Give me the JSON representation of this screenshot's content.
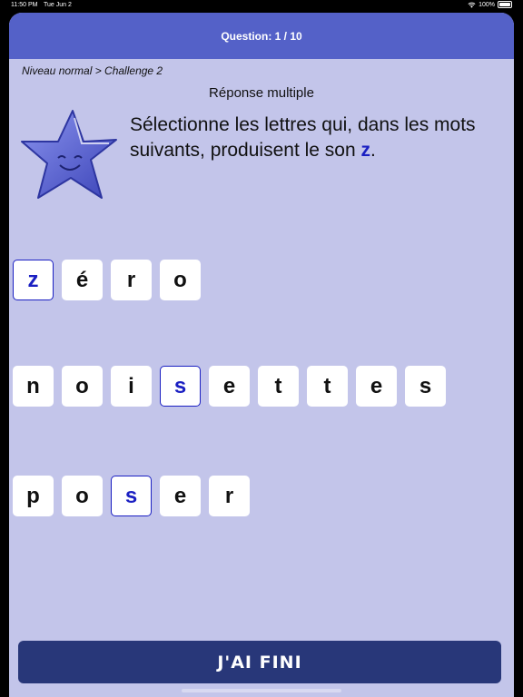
{
  "status": {
    "time": "11:50 PM",
    "date": "Tue Jun 2",
    "battery": "100%"
  },
  "header": {
    "title": "Question: 1 / 10"
  },
  "breadcrumb": "Niveau normal > Challenge 2",
  "question": {
    "type": "Réponse multiple",
    "instruction": "Sélectionne les lettres qui, dans les mots suivants, produisent le son ",
    "target_sound": "z",
    "end": "."
  },
  "words": [
    {
      "letters": [
        "z",
        "é",
        "r",
        "o"
      ],
      "selected": [
        0
      ]
    },
    {
      "letters": [
        "n",
        "o",
        "i",
        "s",
        "e",
        "t",
        "t",
        "e",
        "s"
      ],
      "selected": [
        3
      ]
    },
    {
      "letters": [
        "p",
        "o",
        "s",
        "e",
        "r"
      ],
      "selected": [
        2
      ]
    }
  ],
  "finish_button": "J'AI FINI",
  "colors": {
    "header": "#5461c8",
    "background": "#c3c5ea",
    "accent": "#1a1fc2",
    "button": "#283779"
  },
  "icons": {
    "mascot": "smiling-star-icon"
  }
}
